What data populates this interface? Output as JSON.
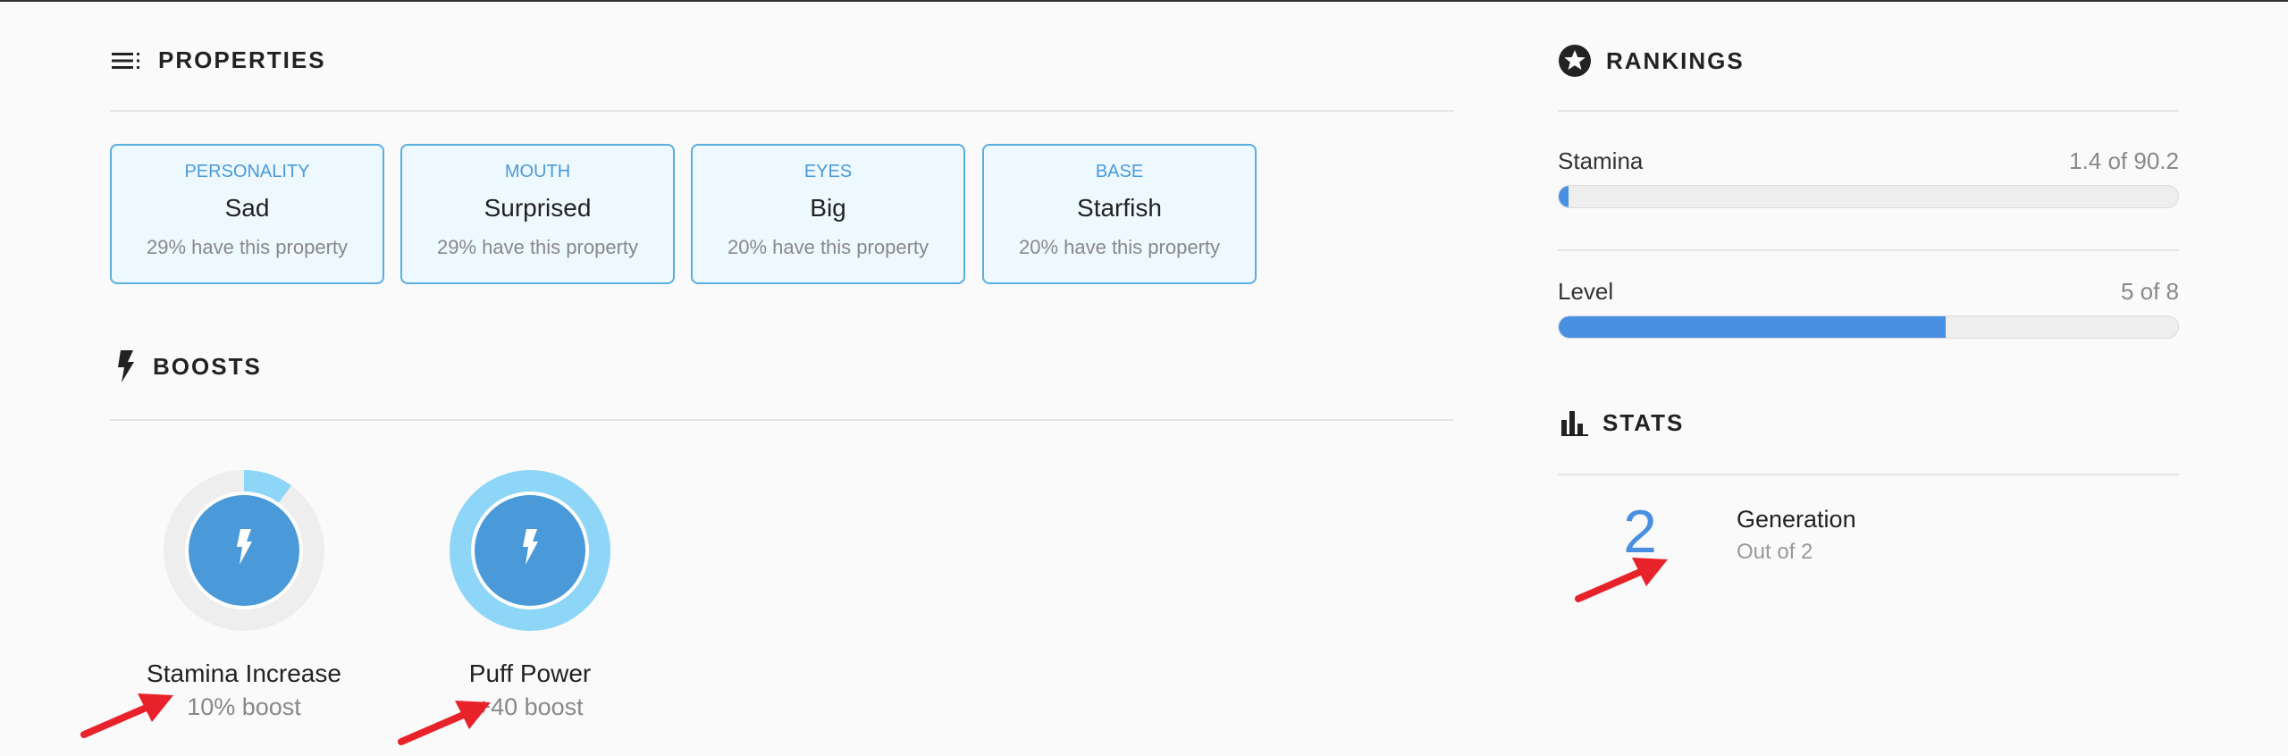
{
  "properties": {
    "title": "PROPERTIES",
    "cards": [
      {
        "label": "PERSONALITY",
        "value": "Sad",
        "pct": "29% have this property"
      },
      {
        "label": "MOUTH",
        "value": "Surprised",
        "pct": "29% have this property"
      },
      {
        "label": "EYES",
        "value": "Big",
        "pct": "20% have this property"
      },
      {
        "label": "BASE",
        "value": "Starfish",
        "pct": "20% have this property"
      }
    ]
  },
  "boosts": {
    "title": "BOOSTS",
    "items": [
      {
        "name": "Stamina Increase",
        "value": "10% boost",
        "ring_fraction": 0.1
      },
      {
        "name": "Puff Power",
        "value": "+40 boost",
        "ring_fraction": 1.0
      }
    ]
  },
  "rankings": {
    "title": "RANKINGS",
    "items": [
      {
        "label": "Stamina",
        "value": "1.4 of 90.2",
        "fraction": 0.0155
      },
      {
        "label": "Level",
        "value": "5 of 8",
        "fraction": 0.625
      }
    ]
  },
  "stats": {
    "title": "STATS",
    "number": "2",
    "label": "Generation",
    "sub": "Out of 2"
  },
  "colors": {
    "accent": "#4a90e2",
    "card_border": "#5aaee0",
    "card_bg": "#eef9ff",
    "ring_light": "#8dd6f7",
    "annotation_arrow": "#e8222a"
  },
  "icons": {
    "properties": "list-icon",
    "boosts": "lightning-icon",
    "rankings": "star-badge-icon",
    "stats": "bar-chart-icon"
  }
}
